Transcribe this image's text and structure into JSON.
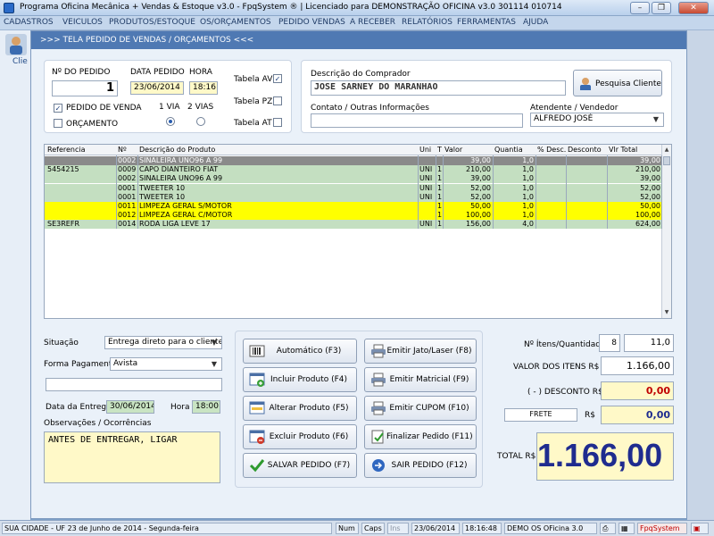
{
  "window": {
    "title": "Programa Oficina Mecânica + Vendas & Estoque v3.0 - FpqSystem ® | Licenciado para  DEMONSTRAÇÃO OFICINA v3.0 301114 010714"
  },
  "menu": [
    "CADASTROS",
    "VEICULOS",
    "PRODUTOS/ESTOQUE",
    "OS/ORÇAMENTOS",
    "PEDIDO VENDAS",
    "A RECEBER",
    "RELATÓRIOS",
    "FERRAMENTAS",
    "AJUDA"
  ],
  "side": {
    "label": "Clie"
  },
  "form": {
    "title": ">>>  TELA PEDIDO DE VENDAS / ORÇAMENTOS  <<<"
  },
  "order": {
    "num_label": "Nº DO PEDIDO",
    "num_value": "1",
    "date_label": "DATA PEDIDO",
    "date_value": "23/06/2014",
    "time_label": "HORA",
    "time_value": "18:16",
    "pedido_label": "PEDIDO DE VENDA",
    "orcamento_label": "ORÇAMENTO",
    "via1_label": "1 VIA",
    "via2_label": "2 VIAS",
    "tabela_av": "Tabela AV",
    "tabela_pz": "Tabela PZ",
    "tabela_at": "Tabela AT"
  },
  "buyer": {
    "desc_label": "Descrição do Comprador",
    "desc_value": "JOSE SARNEY DO MARANHAO",
    "search_button": "Pesquisa Cliente",
    "contact_label": "Contato / Outras Informações",
    "contact_value": "",
    "seller_label": "Atendente / Vendedor",
    "seller_value": "ALFREDO JOSÉ"
  },
  "table": {
    "headers": [
      "Referencia",
      "Nº",
      "Descrição do Produto",
      "Uni",
      "T",
      "Valor",
      "Quantia",
      "% Desc.",
      "Desconto",
      "Vlr Total"
    ],
    "rows": [
      {
        "style": "gray",
        "ref": "",
        "num": "0002",
        "desc": "SINALEIRA UNO96 A 99",
        "uni": "",
        "t": "",
        "valor": "39,00",
        "qtd": "1,0",
        "pdesc": "",
        "desconto": "",
        "total": "39,00"
      },
      {
        "style": "green",
        "ref": "5454215",
        "num": "0009",
        "desc": "CAPO DIANTEIRO FIAT",
        "uni": "UNI",
        "t": "1",
        "valor": "210,00",
        "qtd": "1,0",
        "pdesc": "",
        "desconto": "",
        "total": "210,00"
      },
      {
        "style": "green",
        "ref": "",
        "num": "0002",
        "desc": "SINALEIRA UNO96 A 99",
        "uni": "UNI",
        "t": "1",
        "valor": "39,00",
        "qtd": "1,0",
        "pdesc": "",
        "desconto": "",
        "total": "39,00"
      },
      {
        "style": "green",
        "ref": "",
        "num": "0001",
        "desc": "TWEETER 10",
        "uni": "UNI",
        "t": "1",
        "valor": "52,00",
        "qtd": "1,0",
        "pdesc": "",
        "desconto": "",
        "total": "52,00"
      },
      {
        "style": "green",
        "ref": "",
        "num": "0001",
        "desc": "TWEETER 10",
        "uni": "UNI",
        "t": "1",
        "valor": "52,00",
        "qtd": "1,0",
        "pdesc": "",
        "desconto": "",
        "total": "52,00"
      },
      {
        "style": "yellow",
        "ref": "",
        "num": "0011",
        "desc": "LIMPEZA GERAL S/MOTOR",
        "uni": "",
        "t": "1",
        "valor": "50,00",
        "qtd": "1,0",
        "pdesc": "",
        "desconto": "",
        "total": "50,00"
      },
      {
        "style": "yellow",
        "ref": "",
        "num": "0012",
        "desc": "LIMPEZA GERAL C/MOTOR",
        "uni": "",
        "t": "1",
        "valor": "100,00",
        "qtd": "1,0",
        "pdesc": "",
        "desconto": "",
        "total": "100,00"
      },
      {
        "style": "green",
        "ref": "SE3REFR",
        "num": "0014",
        "desc": "RODA LIGA LEVE 17",
        "uni": "UNI",
        "t": "1",
        "valor": "156,00",
        "qtd": "4,0",
        "pdesc": "",
        "desconto": "",
        "total": "624,00"
      }
    ]
  },
  "bottom": {
    "situacao_label": "Situação",
    "situacao_value": "Entrega direto para o cliente",
    "pagamento_label": "Forma Pagamento",
    "pagamento_value": "Avista",
    "extra_value": "",
    "entrega_label": "Data da Entrega",
    "entrega_value": "30/06/2014",
    "hora_label": "Hora",
    "hora_value": "18:00",
    "obs_label": "Observações / Ocorrências",
    "obs_value": "ANTES DE ENTREGAR, LIGAR"
  },
  "buttons": {
    "automatico": "Automático    (F3)",
    "incluir": "Incluir Produto  (F4)",
    "alterar": "Alterar Produto  (F5)",
    "excluir": "Excluir Produto  (F6)",
    "salvar": "SALVAR PEDIDO (F7)",
    "jato": "Emitir Jato/Laser (F8)",
    "matricial": "Emitir Matricial  (F9)",
    "cupom": "Emitir CUPOM  (F10)",
    "finalizar": "Finalizar Pedido  (F11)",
    "sair": "SAIR  PEDIDO  (F12)"
  },
  "totals": {
    "itens_label": "Nº Ítens/Quantidade",
    "itens_count": "8",
    "itens_qty": "11,0",
    "valor_label": "VALOR DOS ITENS R$",
    "valor_value": "1.166,00",
    "desconto_label": "( - ) DESCONTO R$",
    "desconto_value": "0,00",
    "frete_label": "FRETE",
    "frete_currency": "R$",
    "frete_value": "0,00",
    "total_label": "TOTAL R$",
    "total_value": "1.166,00"
  },
  "status": {
    "location": "SUA CIDADE - UF 23 de Junho de 2014 - Segunda-feira",
    "num": "Num",
    "caps": "Caps",
    "ins": "Ins",
    "date": "23/06/2014",
    "time": "18:16:48",
    "demo": "DEMO OS OFicina 3.0",
    "brand": "FpqSystem"
  }
}
